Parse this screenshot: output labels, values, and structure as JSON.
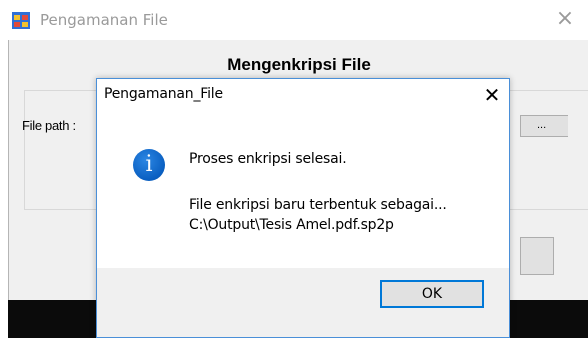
{
  "main_window": {
    "title": "Pengamanan File",
    "close_glyph": "×",
    "heading": "Mengenkripsi File",
    "file_path_label": "File path :",
    "browse_button_label": "..."
  },
  "message_box": {
    "title": "Pengamanan_File",
    "close_glyph": "✕",
    "icon": "info-icon",
    "icon_glyph": "i",
    "lines": [
      "Proses enkripsi selesai.",
      "File enkripsi baru terbentuk sebagai...",
      "C:\\Output\\Tesis Amel.pdf.sp2p"
    ],
    "ok_label": "OK"
  },
  "colors": {
    "info_icon": "#0a5fc1",
    "ok_focus_border": "#0078d7",
    "dialog_border": "#4a8fd8"
  }
}
